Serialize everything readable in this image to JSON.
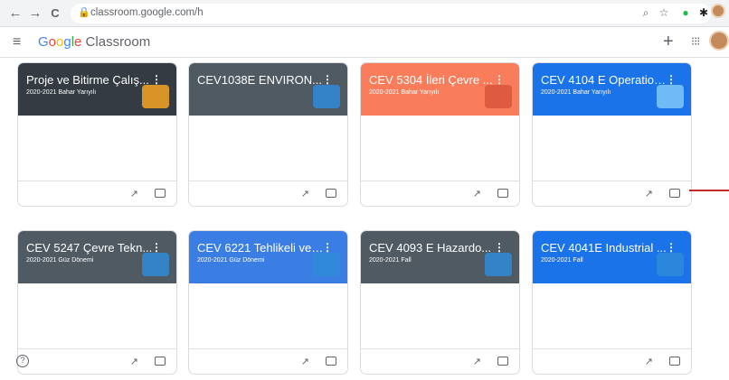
{
  "browser": {
    "back": "←",
    "forward": "→",
    "reload": "C",
    "url": "classroom.google.com/h",
    "lock": "🔒"
  },
  "app": {
    "menu_icon": "≡",
    "brand_google": "Google",
    "brand_product": " Classroom",
    "add_icon": "+",
    "apps_icon": "⋮⋮⋮",
    "colors": {
      "blue": "#4285f4",
      "red": "#ea4335",
      "yellow": "#fbbc05",
      "green": "#34a853"
    }
  },
  "classes": [
    {
      "title": "Proje ve Bitirme Çalış...",
      "term": "2020-2021 Bahar Yarıyılı",
      "color": "#343b42",
      "deco": "#f5a623"
    },
    {
      "title": "CEV1038E ENVIRON...",
      "term": "",
      "color": "#4f5a63",
      "deco": "#2f8bd8"
    },
    {
      "title": "CEV 5304 İleri Çevre ...",
      "term": "2020-2021 Bahar Yarıyılı",
      "color": "#f97d5b",
      "deco": "#d9533d"
    },
    {
      "title": "CEV 4104 E Operation...",
      "term": "2020-2021 Bahar Yarıyılı",
      "color": "#1a73e8",
      "deco": "#7fc8f8"
    },
    {
      "title": "CEV 5247 Çevre Tekn...",
      "term": "2020-2021 Güz Dönemi",
      "color": "#4f5a63",
      "deco": "#2f8bd8"
    },
    {
      "title": "CEV 6221 Tehlikeli ve ...",
      "term": "2020-2021 Güz Dönemi",
      "color": "#3a7ee4",
      "deco": "#2f8bd8"
    },
    {
      "title": "CEV 4093 E Hazardo...",
      "term": "2020-2021 Fall",
      "color": "#4f5a63",
      "deco": "#2f8bd8"
    },
    {
      "title": "CEV 4041E Industrial ...",
      "term": "2020-2021 Fall",
      "color": "#1a73e8",
      "deco": "#2f8bd8"
    }
  ],
  "card_icons": {
    "trend": "↗",
    "folder": "folder-icon"
  },
  "help_icon": "?"
}
